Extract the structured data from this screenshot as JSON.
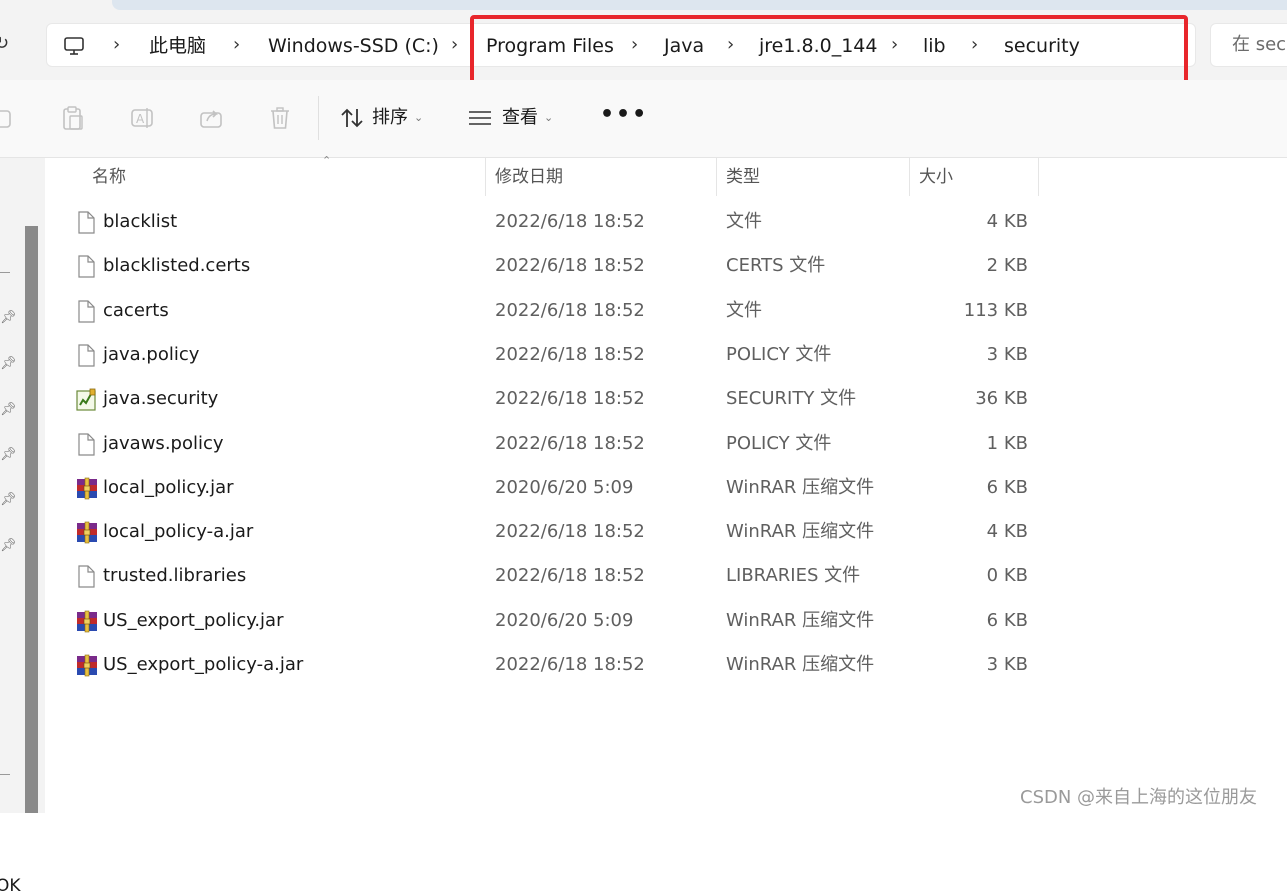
{
  "address": {
    "crumbs": [
      "此电脑",
      "Windows-SSD (C:)",
      "Program Files",
      "Java",
      "jre1.8.0_144",
      "lib",
      "security"
    ],
    "search_placeholder": "在 sec"
  },
  "toolbar": {
    "sort_label": "排序",
    "view_label": "查看"
  },
  "columns": {
    "name": "名称",
    "date": "修改日期",
    "type": "类型",
    "size": "大小"
  },
  "files": [
    {
      "name": "blacklist",
      "date": "2022/6/18 18:52",
      "type": "文件",
      "size": "4 KB",
      "icon": "file-icon"
    },
    {
      "name": "blacklisted.certs",
      "date": "2022/6/18 18:52",
      "type": "CERTS 文件",
      "size": "2 KB",
      "icon": "file-icon"
    },
    {
      "name": "cacerts",
      "date": "2022/6/18 18:52",
      "type": "文件",
      "size": "113 KB",
      "icon": "file-icon"
    },
    {
      "name": "java.policy",
      "date": "2022/6/18 18:52",
      "type": "POLICY 文件",
      "size": "3 KB",
      "icon": "file-icon"
    },
    {
      "name": "java.security",
      "date": "2022/6/18 18:52",
      "type": "SECURITY 文件",
      "size": "36 KB",
      "icon": "security-file-icon"
    },
    {
      "name": "javaws.policy",
      "date": "2022/6/18 18:52",
      "type": "POLICY 文件",
      "size": "1 KB",
      "icon": "file-icon"
    },
    {
      "name": "local_policy.jar",
      "date": "2020/6/20 5:09",
      "type": "WinRAR 压缩文件",
      "size": "6 KB",
      "icon": "winrar-icon"
    },
    {
      "name": "local_policy-a.jar",
      "date": "2022/6/18 18:52",
      "type": "WinRAR 压缩文件",
      "size": "4 KB",
      "icon": "winrar-icon"
    },
    {
      "name": "trusted.libraries",
      "date": "2022/6/18 18:52",
      "type": "LIBRARIES 文件",
      "size": "0 KB",
      "icon": "file-icon"
    },
    {
      "name": "US_export_policy.jar",
      "date": "2020/6/20 5:09",
      "type": "WinRAR 压缩文件",
      "size": "6 KB",
      "icon": "winrar-icon"
    },
    {
      "name": "US_export_policy-a.jar",
      "date": "2022/6/18 18:52",
      "type": "WinRAR 压缩文件",
      "size": "3 KB",
      "icon": "winrar-icon"
    }
  ],
  "nav": {
    "partial_label": "OK"
  },
  "watermark": "CSDN @来自上海的这位朋友",
  "colors": {
    "highlight": "#e8262b",
    "address_bg": "#ffffff",
    "chrome_bg": "#f3f3f3"
  }
}
